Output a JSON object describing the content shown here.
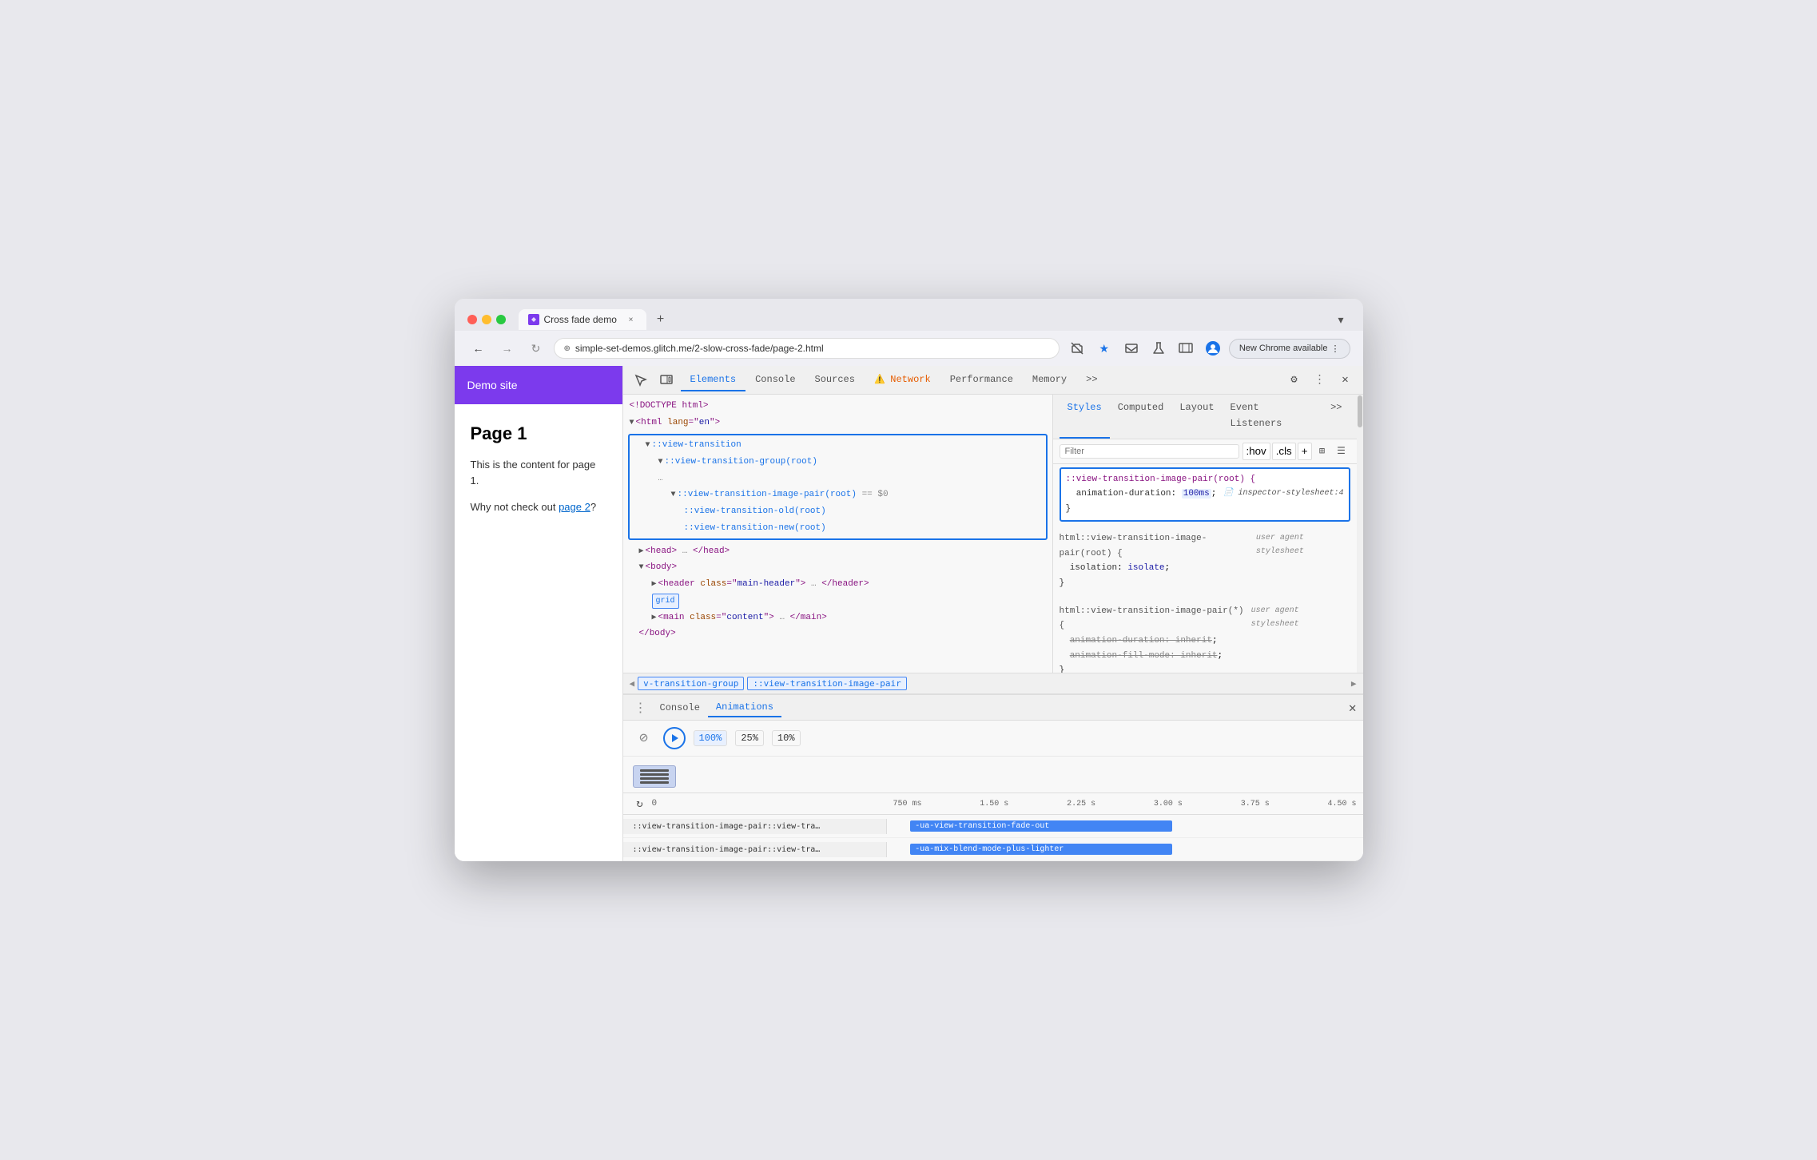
{
  "browser": {
    "tab_label": "Cross fade demo",
    "url": "simple-set-demos.glitch.me/2-slow-cross-fade/page-2.html",
    "new_chrome_label": "New Chrome available",
    "tab_close": "×",
    "tab_new": "+",
    "tab_list": "▾"
  },
  "demo_site": {
    "header": "Demo site",
    "h1": "Page 1",
    "p1": "This is the content for page 1.",
    "p2": "Why not check out ",
    "link": "page 2",
    "p2_end": "?"
  },
  "devtools": {
    "tabs": [
      "Elements",
      "Console",
      "Sources",
      "Network",
      "Performance",
      "Memory",
      ">>"
    ],
    "active_tab": "Elements",
    "network_warning": true,
    "close_label": "×",
    "breadcrumb_items": [
      "v-transition-group",
      "::view-transition-image-pair"
    ],
    "html_lines": [
      "<!DOCTYPE html>",
      "<html lang=\"en\">",
      "::view-transition",
      "::view-transition-group(root)",
      "::view-transition-image-pair(root) == $0",
      "::view-transition-old(root)",
      "::view-transition-new(root)",
      "<head>… </head>",
      "<body>",
      "<header class=\"main-header\">… </header>",
      "grid",
      "<main class=\"content\">… </main>",
      "</body>"
    ]
  },
  "styles": {
    "tabs": [
      "Styles",
      "Computed",
      "Layout",
      "Event Listeners",
      ">>"
    ],
    "active_tab": "Styles",
    "filter_placeholder": "Filter",
    "hov_label": ":hov",
    "cls_label": ".cls",
    "rules": [
      {
        "selector": "::view-transition-image-pair(root) {",
        "source": "inspector-stylesheet:4",
        "properties": [
          {
            "name": "animation-duration",
            "value": "100ms",
            "highlight": true
          }
        ],
        "close": "}"
      },
      {
        "selector": "html::view-transition-image-pair(root) {",
        "source": "user agent stylesheet",
        "properties": [
          {
            "name": "isolation",
            "value": "isolate"
          }
        ],
        "close": "}"
      },
      {
        "selector": "html::view-transition-image-pair(*) {",
        "source": "user agent stylesheet",
        "properties": [
          {
            "name": "animation-duration",
            "value": "inherit",
            "strikethrough": true
          },
          {
            "name": "animation-fill-mode",
            "value": "inherit",
            "strikethrough": true
          }
        ],
        "close": "}"
      }
    ]
  },
  "animations": {
    "bottom_tabs": [
      "Console",
      "Animations"
    ],
    "active_bottom_tab": "Animations",
    "speeds": [
      "100%",
      "25%",
      "10%"
    ],
    "timeline_labels": [
      "0",
      "750 ms",
      "1.50 s",
      "2.25 s",
      "3.00 s",
      "3.75 s",
      "4.50 s"
    ],
    "rows": [
      {
        "label": "::view-transition-image-pair::view-tra…",
        "bar_label": "-ua-view-transition-fade-out",
        "bar_left": "30%",
        "bar_width": "38%"
      },
      {
        "label": "::view-transition-image-pair::view-tra…",
        "bar_label": "-ua-mix-blend-mode-plus-lighter",
        "bar_left": "30%",
        "bar_width": "38%"
      }
    ]
  }
}
